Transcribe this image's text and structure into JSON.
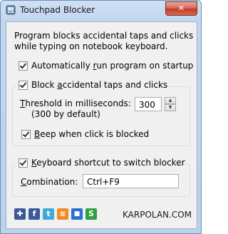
{
  "window": {
    "title": "Touchpad Blocker",
    "close_glyph": "✕"
  },
  "description_lines": [
    "Program blocks accidental taps and clicks",
    "while typing on notebook keyboard."
  ],
  "autorun": {
    "label_pre": "Automatically ",
    "label_u": "r",
    "label_post": "un program on startup",
    "checked": true
  },
  "block_group": {
    "label_pre": "Block ",
    "label_u": "a",
    "label_post": "ccidental taps and clicks",
    "checked": true,
    "threshold_label_pre": "",
    "threshold_label_u": "T",
    "threshold_label_post": "hreshold in milliseconds:",
    "threshold_default": "(300 by default)",
    "threshold_value": "300",
    "beep": {
      "label_pre": "",
      "label_u": "B",
      "label_post": "eep when click is blocked",
      "checked": true
    }
  },
  "shortcut_group": {
    "label_pre": "",
    "label_u": "K",
    "label_post": "eyboard shortcut to switch blocker",
    "checked": true,
    "combination_label_pre": "",
    "combination_label_u": "C",
    "combination_label_post": "ombination:",
    "combination_value": "Ctrl+F9"
  },
  "footer": {
    "social_icons": [
      {
        "name": "delicious-icon",
        "glyph": "✚",
        "color": "#3b5998"
      },
      {
        "name": "facebook-icon",
        "glyph": "f",
        "color": "#3b5998"
      },
      {
        "name": "twitter-icon",
        "glyph": "t",
        "color": "#3fa9d9"
      },
      {
        "name": "rss-icon",
        "glyph": "≋",
        "color": "#f08a24"
      },
      {
        "name": "delicious-squares-icon",
        "glyph": "■",
        "color": "#2a6fd6"
      },
      {
        "name": "stumble-icon",
        "glyph": "S",
        "color": "#2fa043"
      }
    ],
    "site": "KARPOLAN.COM"
  }
}
